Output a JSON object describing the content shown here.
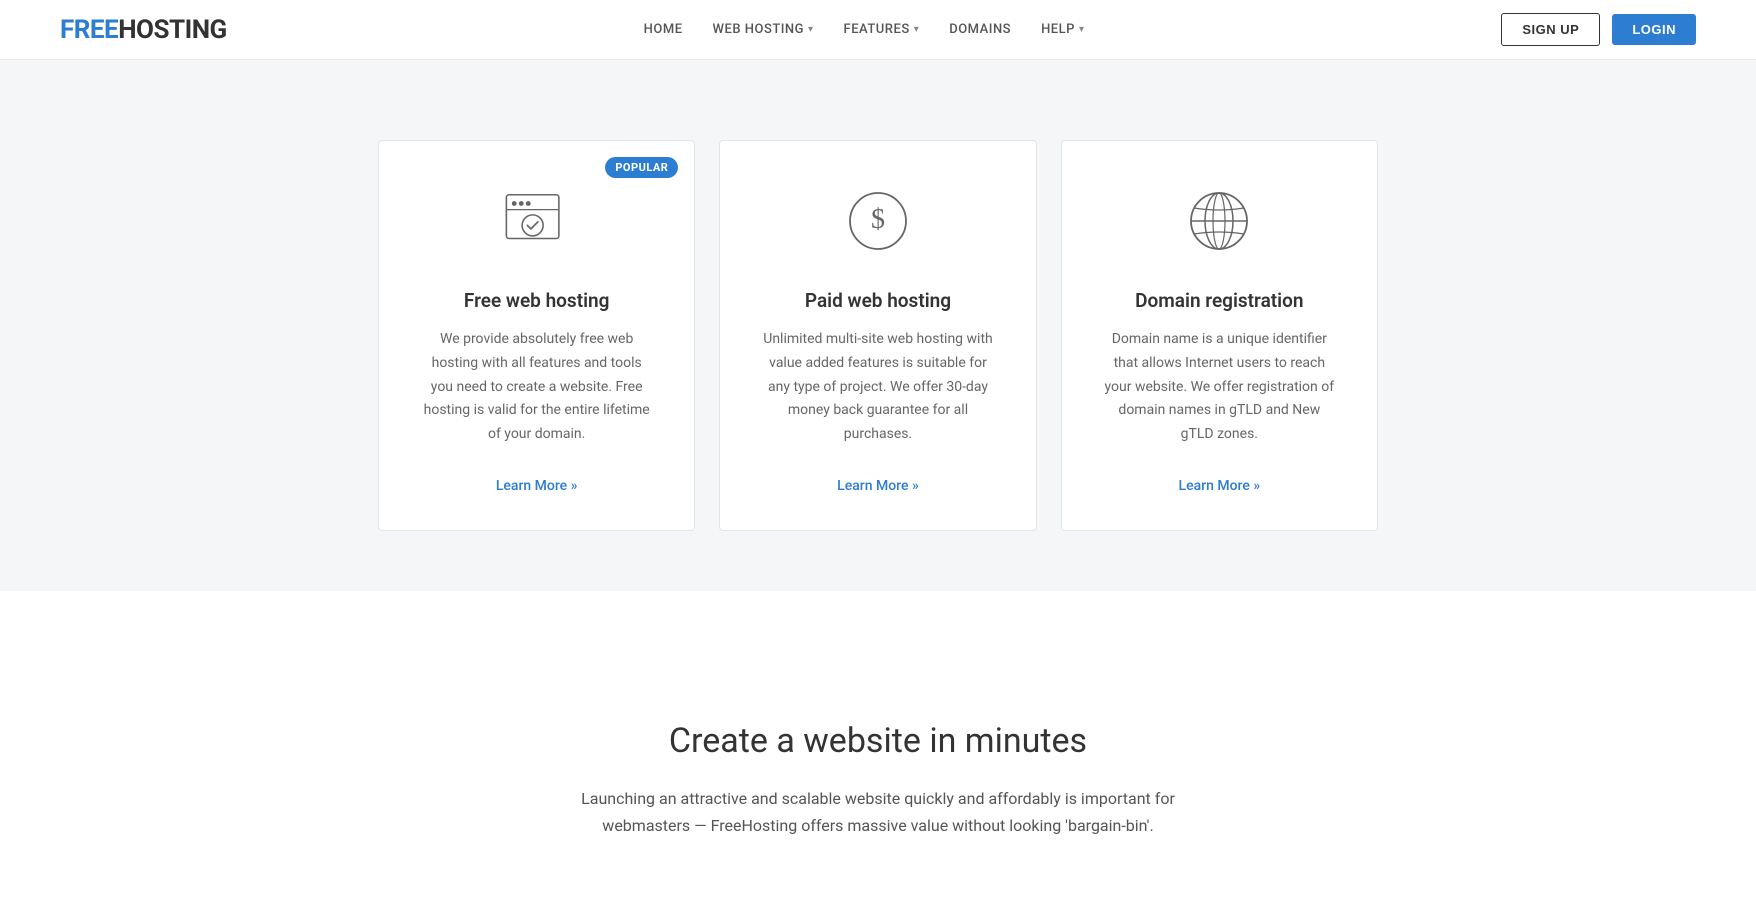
{
  "logo": {
    "free": "FREE",
    "hosting": "HOSTING"
  },
  "nav": {
    "items": [
      {
        "label": "HOME",
        "dropdown": false
      },
      {
        "label": "WEB HOSTING",
        "dropdown": true
      },
      {
        "label": "FEATURES",
        "dropdown": true
      },
      {
        "label": "DOMAINS",
        "dropdown": false
      },
      {
        "label": "HELP",
        "dropdown": true
      }
    ]
  },
  "header_buttons": {
    "signup": "SIGN UP",
    "login": "LOGIN"
  },
  "cards": [
    {
      "id": "free-hosting",
      "title": "Free web hosting",
      "desc": "We provide absolutely free web hosting with all features and tools you need to create a website. Free hosting is valid for the entire lifetime of your domain.",
      "link": "Learn More »",
      "popular": true,
      "icon": "browser-check"
    },
    {
      "id": "paid-hosting",
      "title": "Paid web hosting",
      "desc": "Unlimited multi-site web hosting with value added features is suitable for any type of project. We offer 30-day money back guarantee for all purchases.",
      "link": "Learn More »",
      "popular": false,
      "icon": "dollar"
    },
    {
      "id": "domain-registration",
      "title": "Domain registration",
      "desc": "Domain name is a unique identifier that allows Internet users to reach your website. We offer registration of domain names in gTLD and New gTLD zones.",
      "link": "Learn More »",
      "popular": false,
      "icon": "globe"
    }
  ],
  "popular_label": "POPULAR",
  "create_section": {
    "title": "Create a website in minutes",
    "desc": "Launching an attractive and scalable website quickly and affordably is important for webmasters — FreeHosting offers massive value without looking 'bargain-bin'."
  }
}
